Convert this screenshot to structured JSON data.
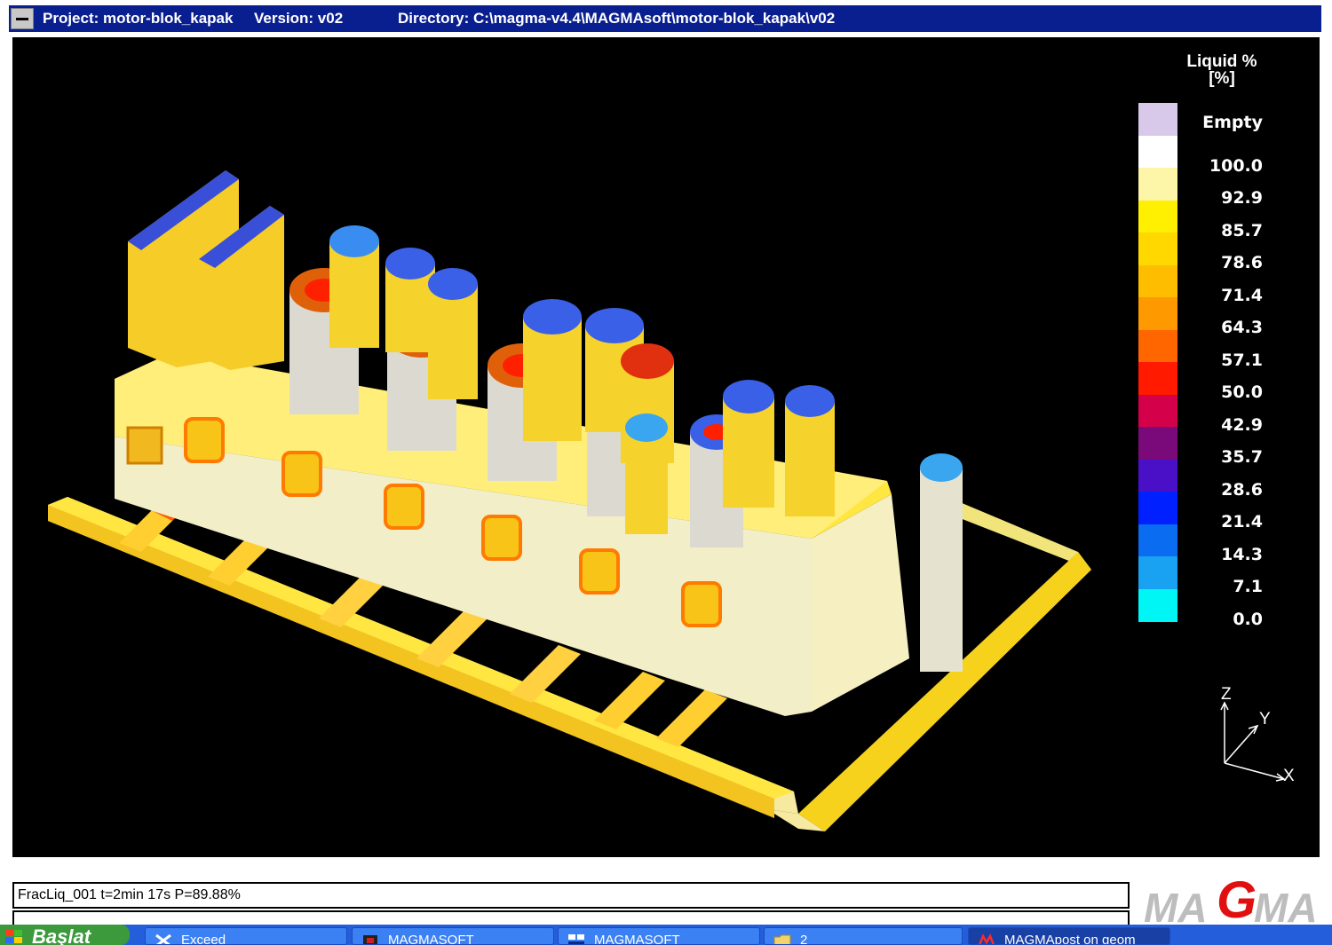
{
  "window": {
    "project": "Project: motor-blok_kapak",
    "version": "Version: v02",
    "directory": "Directory: C:\\magma-v4.4\\MAGMAsoft\\motor-blok_kapak\\v02"
  },
  "legend": {
    "title_line1": "Liquid %",
    "title_line2": "[%]",
    "entries": [
      {
        "label": "Empty",
        "color": "#d8c8ea"
      },
      {
        "label": "100.0",
        "color": "#ffffff"
      },
      {
        "label": "92.9",
        "color": "#fdf5a8"
      },
      {
        "label": "85.7",
        "color": "#ffef00"
      },
      {
        "label": "78.6",
        "color": "#ffd800"
      },
      {
        "label": "71.4",
        "color": "#ffbd00"
      },
      {
        "label": "64.3",
        "color": "#ff9900"
      },
      {
        "label": "57.1",
        "color": "#ff6600"
      },
      {
        "label": "50.0",
        "color": "#ff1a00"
      },
      {
        "label": "42.9",
        "color": "#d4004a"
      },
      {
        "label": "35.7",
        "color": "#7a0a7a"
      },
      {
        "label": "28.6",
        "color": "#4a10c8"
      },
      {
        "label": "21.4",
        "color": "#0020ff"
      },
      {
        "label": "14.3",
        "color": "#0a6cf0"
      },
      {
        "label": "7.1",
        "color": "#19a2f2"
      },
      {
        "label": "0.0",
        "color": "#00f5f5"
      }
    ]
  },
  "axes": {
    "z": "Z",
    "y": "Y",
    "x": "X"
  },
  "status": {
    "text": "FracLiq_001 t=2min 17s P=89.88%"
  },
  "logo": {
    "text": "MAGMA"
  },
  "taskbar": {
    "start_label": "Başlat",
    "buttons": [
      {
        "label": "Exceed"
      },
      {
        "label": "MAGMASOFT"
      },
      {
        "label": "MAGMASOFT"
      },
      {
        "label": "2"
      },
      {
        "label": "MAGMApost on geom"
      }
    ]
  }
}
